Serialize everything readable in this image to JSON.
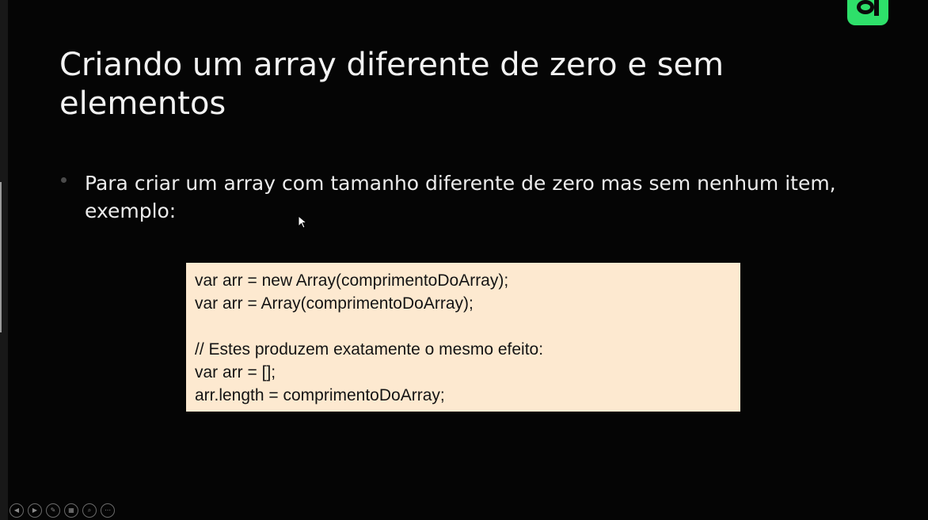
{
  "slide": {
    "title": "Criando um array diferente de zero e sem elementos",
    "bullet": "Para criar um array com tamanho diferente de zero mas sem nenhum item, exemplo:",
    "code_lines": [
      "var arr = new Array(comprimentoDoArray);",
      "var arr = Array(comprimentoDoArray);",
      "",
      "// Estes produzem exatamente o mesmo efeito:",
      "var arr = [];",
      "arr.length = comprimentoDoArray;"
    ]
  },
  "toolbar": {
    "buttons": [
      {
        "icon": "previous-slide-icon",
        "glyph": "◀"
      },
      {
        "icon": "next-slide-icon",
        "glyph": "▶"
      },
      {
        "icon": "pen-icon",
        "glyph": "✎"
      },
      {
        "icon": "slides-overview-icon",
        "glyph": "▦"
      },
      {
        "icon": "zoom-icon",
        "glyph": "⌕"
      },
      {
        "icon": "more-options-icon",
        "glyph": "⋯"
      }
    ]
  },
  "colors": {
    "background": "#040404",
    "text": "#f2f2f2",
    "code_background": "#fde9d0",
    "logo_accent": "#2ee06a"
  }
}
